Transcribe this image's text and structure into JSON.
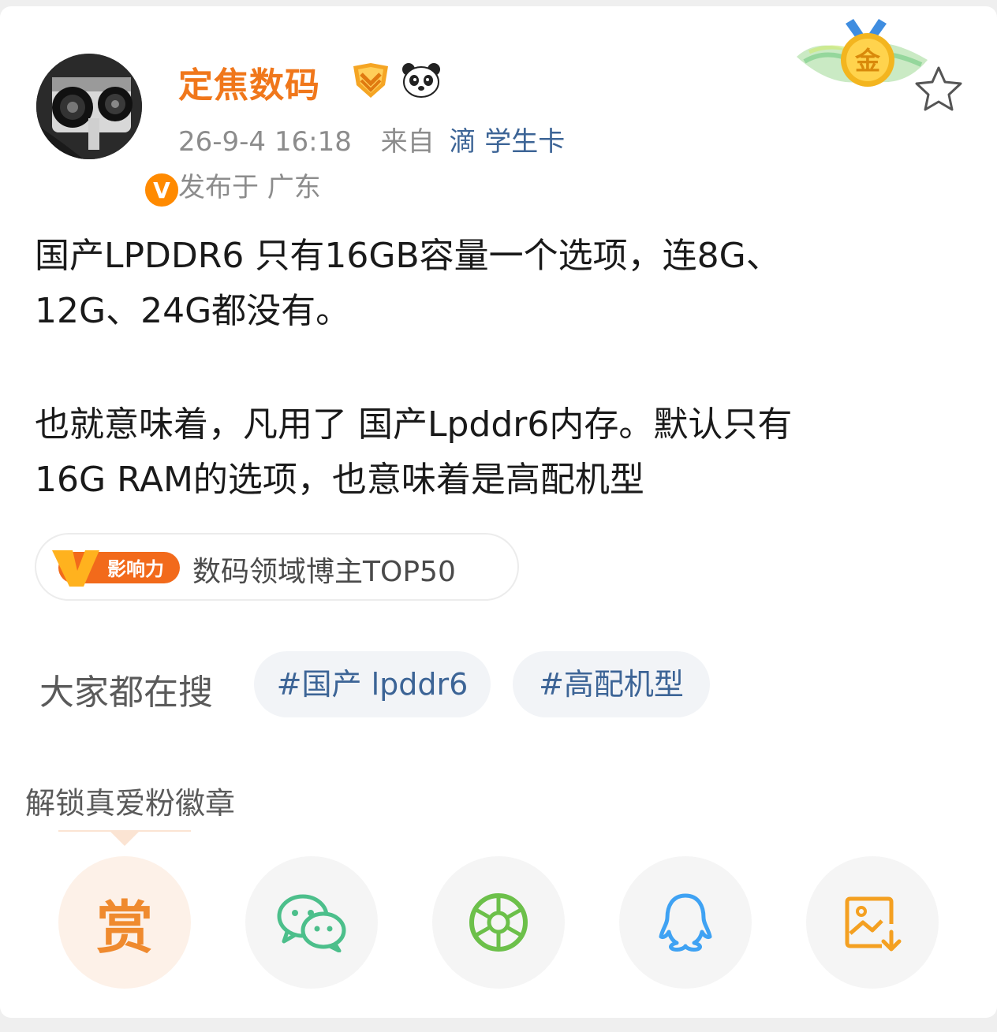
{
  "post": {
    "author": {
      "name": "定焦数码",
      "verified_mark": "V",
      "badges": [
        "level-badge-icon",
        "panda-icon"
      ]
    },
    "timestamp": "26-9-4 16:18",
    "source_prefix": "来自",
    "source_name": "滴 学生卡",
    "location": "发布于 广东",
    "text_lines": [
      "国产LPDDR6 只有16GB容量一个选项，连8G、",
      "12G、24G都没有。",
      "也就意味着，凡用了 国产Lpddr6内存。默认只有",
      "16G RAM的选项，也意味着是高配机型"
    ],
    "medal_label": "金",
    "influence": {
      "tag_v": "V",
      "tag_text": "影响力",
      "label": "数码领域博主TOP50"
    },
    "search": {
      "label": "大家都在搜",
      "chips": [
        "#国产 lpddr6",
        "#高配机型"
      ]
    },
    "fan_badge": {
      "label": "解锁真爱粉徽章"
    },
    "share": {
      "reward_label": "赏",
      "buttons": [
        "reward-button",
        "wechat-share",
        "moments-share",
        "qq-share",
        "save-image"
      ]
    }
  },
  "colors": {
    "accent_orange": "#f0771b",
    "link_blue": "#3c6496",
    "wechat_green": "#4cbf8b",
    "moments_green": "#6cc04a",
    "qq_blue": "#3fa2f3",
    "save_orange": "#f4a021"
  }
}
